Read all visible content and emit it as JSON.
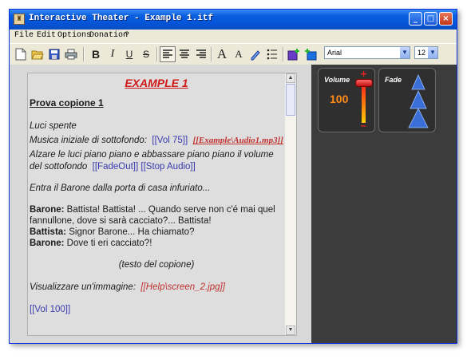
{
  "window": {
    "title": "Interactive Theater - Example 1.itf",
    "controls": {
      "minimize": "_",
      "maximize": "□",
      "close": "×"
    }
  },
  "menu": {
    "items": [
      "File",
      "Edit",
      "Options",
      "Donation",
      "?"
    ]
  },
  "toolbar": {
    "font_name": "Arial",
    "font_size": "12",
    "buttons": [
      "new-file",
      "open-folder",
      "save",
      "print",
      "bold",
      "italic",
      "underline",
      "strike",
      "align-left",
      "align-center",
      "align-right",
      "font-grow",
      "font-shrink",
      "highlight",
      "bullet-list",
      "insert-image",
      "insert-audio"
    ],
    "labels": {
      "bold": "B",
      "italic": "I",
      "underline": "U",
      "strike": "S",
      "grow": "A",
      "shrink": "A"
    }
  },
  "document": {
    "heading": "EXAMPLE 1",
    "subtitle": "Prova copione 1",
    "luci": "Luci spente",
    "musica_text": "Musica iniziale di sottofondo:",
    "vol75": "[[Vol 75]]",
    "audio": "[[Example\\Audio1.mp3]]",
    "alzare_1": "Alzare le luci piano piano e abbassare piano piano il volume",
    "alzare_2": "del sottofondo",
    "fadeout": "[[FadeOut]]",
    "stopaudio": "[[Stop Audio]]",
    "entra": "Entra il Barone dalla porta di casa infuriato...",
    "barone_label": "Barone:",
    "barone_line1": "Battista! Battista! ... Quando serve non c'é mai quel",
    "barone_line2": "fannullone, dove si sarà cacciato?... Battista!",
    "battista_label": "Battista:",
    "battista_line": "Signor Barone... Ha chiamato?",
    "barone2_label": "Barone:",
    "barone2_line": "Dove ti eri cacciato?!",
    "testo": "(testo del copione)",
    "visualizzare": "Visualizzare un'immagine:",
    "image_tag": "[[Help\\screen_2.jpg]]",
    "vol100": "[[Vol 100]]"
  },
  "volume_panel": {
    "label": "Volume",
    "value": "100",
    "level": 1.0,
    "plus": "+",
    "minus": "−"
  },
  "fade_panel": {
    "label": "Fade"
  },
  "colors": {
    "title_bar": "#0554d8",
    "heading": "#d01818",
    "tag_blue": "#3a3ab0",
    "tag_red": "#c03030",
    "volume_value": "#ff8c1a",
    "fade_triangle": "#3a6fd8"
  }
}
